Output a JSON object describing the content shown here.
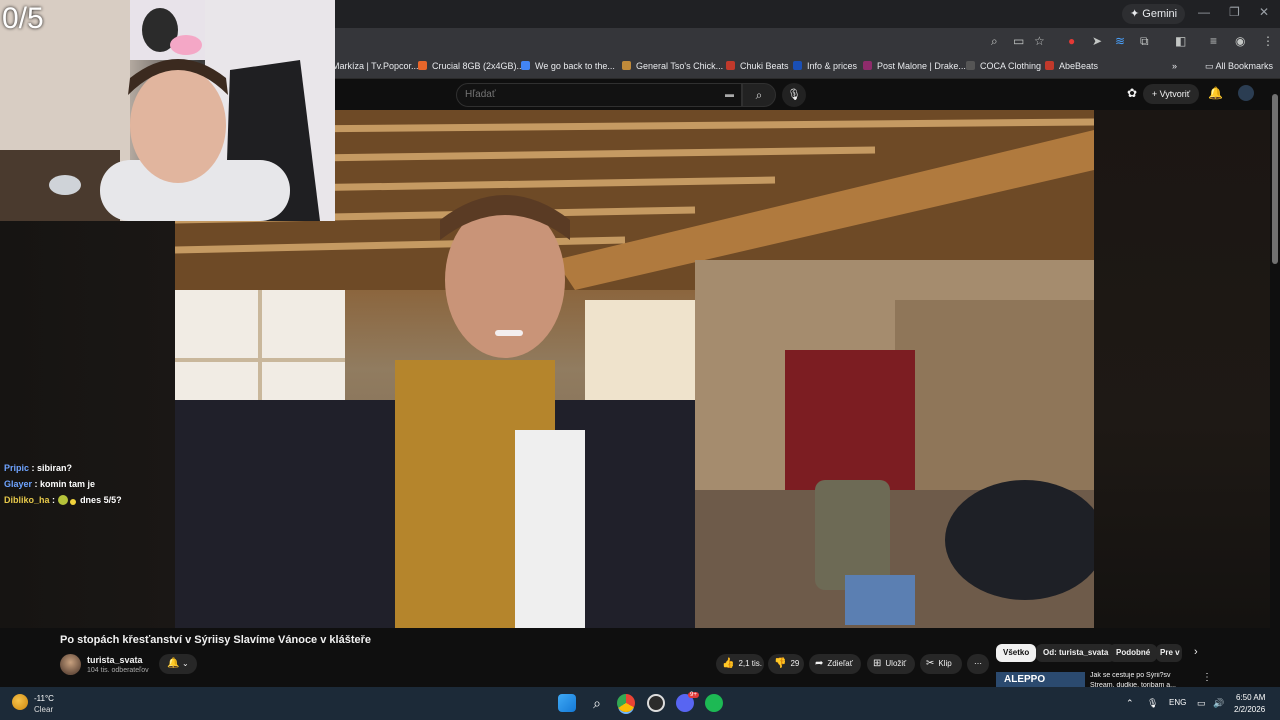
{
  "browser": {
    "gemini_label": "Gemini",
    "bookmarks": [
      {
        "label": "Markíza | Tv.Popcor...",
        "color": "#3a4a8c"
      },
      {
        "label": "Crucial 8GB (2x4GB)...",
        "color": "#e8662a"
      },
      {
        "label": "We go back to the...",
        "color": "#4285f4"
      },
      {
        "label": "General Tso's Chick...",
        "color": "#c08a3a"
      },
      {
        "label": "Chuki Beats",
        "color": "#c0392b"
      },
      {
        "label": "Info & prices",
        "color": "#1a4fb5"
      },
      {
        "label": "Post Malone | Drake...",
        "color": "#8e2b6b"
      },
      {
        "label": "COCA Clothing",
        "color": "#333333"
      },
      {
        "label": "AbeBeats",
        "color": "#c0392b"
      }
    ],
    "all_bookmarks": "All Bookmarks"
  },
  "youtube": {
    "search_placeholder": "Hľadať",
    "create_label": "Vytvoriť",
    "video_title": "Po stopách křesťanství v Sýriisy Slavíme Vánoce v klášteře",
    "channel_name": "turista_svata",
    "channel_subs": "104 tis. odberateľov",
    "actions": {
      "likes": "2,1 tis.",
      "dislikes": "29",
      "share": "Zdieľať",
      "save": "Uložiť",
      "clip": "Klip"
    },
    "chips": [
      "Všetko",
      "Od: turista_svata",
      "Podobné",
      "Pre v"
    ],
    "related": {
      "thumb_text": "ALEPPO",
      "title_line1": "Jak se cestuje po Sýrii?sv",
      "title_line2": "Stream, dudkie, toribam a..."
    }
  },
  "stream": {
    "counter": "0/5",
    "chat": [
      {
        "user": "Pripic",
        "user_color": "#6ea3ff",
        "text": ": sibiran?"
      },
      {
        "user": "Glayer",
        "user_color": "#6ea3ff",
        "text": ": komin tam je"
      },
      {
        "user": "Dibliko_ha",
        "user_color": "#e6c84a",
        "text": "dnes 5/5?",
        "sep": ":"
      }
    ]
  },
  "taskbar": {
    "temp": "-11°C",
    "condition": "Clear",
    "lang": "ENG",
    "time": "6:50 AM",
    "date": "2/2/2026",
    "discord_badge": "9+"
  }
}
